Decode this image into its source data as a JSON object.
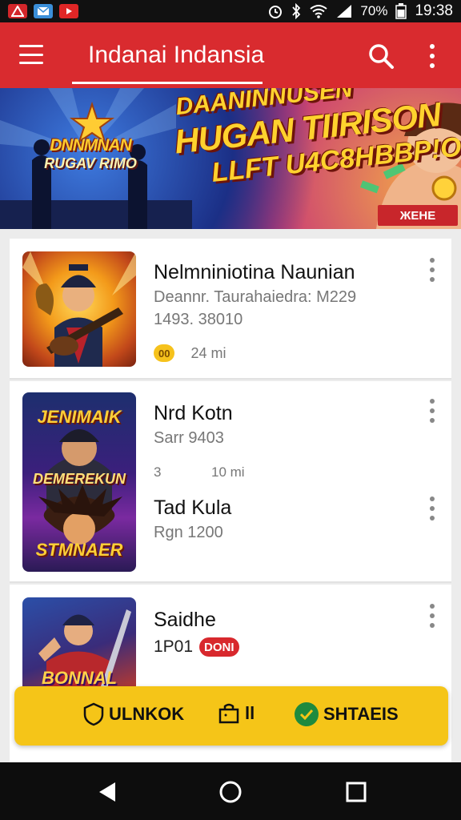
{
  "status_bar": {
    "battery": "70%",
    "time": "19:38",
    "icons": [
      "alert-app-icon",
      "mail-app-icon",
      "video-app-icon",
      "alarm-icon",
      "bluetooth-icon",
      "wifi-icon",
      "signal-icon",
      "battery-icon"
    ]
  },
  "app_bar": {
    "title": "Indanai Indansia",
    "icons": [
      "menu-icon",
      "search-icon",
      "more-vert-icon"
    ]
  },
  "banner": {
    "logo_line_1": "DNNMNAN",
    "logo_line_2": "RUGAV RIMO",
    "headline_1": "DAANINNUSEN",
    "headline_2": "HUGAN TIIRISON",
    "headline_3": "LLFT U4C8HBBP!O",
    "badge": "ЖЕНЕ"
  },
  "items": [
    {
      "title": "Nelmniniotina Naunian",
      "subtitle": "Deannr. Taurahaiedra: M229",
      "meta": "1493. 38010",
      "badge": "00",
      "extra": "24 mi"
    },
    {
      "title": "Nrd Kotn",
      "subtitle": "Sarr 9403",
      "meta_left": "3",
      "meta_right": "10 mi",
      "title_2": "Tad Kula",
      "subtitle_2": "Rgn 1200",
      "thumb_caption_top": "JENIMAIK",
      "thumb_caption_mid": "DEMEREKUN",
      "thumb_caption_bottom": "STMNAER"
    },
    {
      "title": "Saidhe",
      "meta": "1P01",
      "price": "DONI",
      "thumb_caption": "BONNAL"
    }
  ],
  "action_bar": {
    "unlock_label": "ULNKOK",
    "bag_label": "ll",
    "share_label": "SHTAEIS"
  },
  "colors": {
    "app_bar": "#d92b2f",
    "action_bar": "#f5c518",
    "check": "#1e8a3e"
  }
}
